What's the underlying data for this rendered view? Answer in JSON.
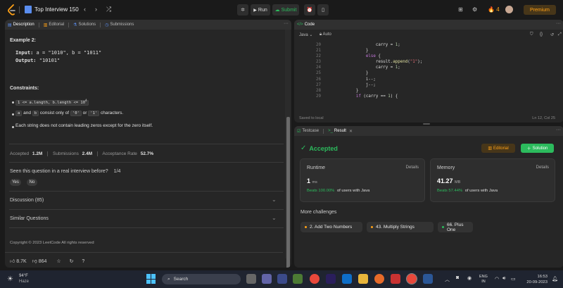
{
  "topbar": {
    "problem_list_title": "Top Interview 150",
    "prev_label": "‹",
    "next_label": "›",
    "shuffle_label": "⤮",
    "run_label": "Run",
    "submit_label": "Submit",
    "streak_count": "4",
    "premium_label": "Premium"
  },
  "description_panel": {
    "tabs": [
      "Description",
      "Editorial",
      "Solutions",
      "Submissions"
    ],
    "example_title": "Example 2:",
    "input_label": "Input:",
    "input_value": "a = \"1010\", b = \"1011\"",
    "output_label": "Output:",
    "output_value": "\"10101\"",
    "constraints_title": "Constraints:",
    "constraint_1_code": "1 <= a.length, b.length <= 10",
    "constraint_1_exp": "4",
    "constraint_2_a": "a",
    "constraint_2_and": "and",
    "constraint_2_b": "b",
    "constraint_2_text": "consist only of",
    "constraint_2_zero": "'0'",
    "constraint_2_or": "or",
    "constraint_2_one": "'1'",
    "constraint_2_end": "characters.",
    "constraint_3": "Each string does not contain leading zeros except for the zero itself.",
    "accepted_label": "Accepted",
    "accepted_value": "1.2M",
    "submissions_label": "Submissions",
    "submissions_value": "2.4M",
    "acceptance_label": "Acceptance Rate",
    "acceptance_value": "52.7%",
    "interview_question": "Seen this question in a real interview before?",
    "interview_ratio": "1/4",
    "yes_label": "Yes",
    "no_label": "No",
    "discussion_label": "Discussion (85)",
    "similar_label": "Similar Questions",
    "copyright": "Copyright © 2023 LeetCode All rights reserved",
    "likes": "8.7K",
    "dislikes": "864"
  },
  "code_panel": {
    "title": "Code",
    "language": "Java",
    "auto_label": "Auto",
    "line_numbers": [
      "20",
      "21",
      "22",
      "23",
      "24",
      "25",
      "26",
      "27",
      "28",
      "29",
      "30"
    ],
    "saved_label": "Saved to local",
    "cursor_position": "Ln 12, Col 25"
  },
  "result_panel": {
    "tabs": [
      "Testcase",
      "Result"
    ],
    "status": "Accepted",
    "editorial_btn": "Editorial",
    "solution_btn": "Solution",
    "runtime_label": "Runtime",
    "runtime_details": "Details",
    "runtime_value": "1",
    "runtime_unit": "ms",
    "runtime_beats": "Beats 100.00%",
    "runtime_beats_suffix": "of users with Java",
    "memory_label": "Memory",
    "memory_details": "Details",
    "memory_value": "41.27",
    "memory_unit": "MB",
    "memory_beats": "Beats 57.44%",
    "memory_beats_suffix": "of users with Java",
    "more_challenges_label": "More challenges",
    "challenges": [
      "2. Add Two Numbers",
      "43. Multiply Strings",
      "66. Plus One"
    ]
  },
  "taskbar": {
    "temperature": "94°F",
    "weather": "Haze",
    "search_placeholder": "Search",
    "lang_1": "ENG",
    "lang_2": "IN",
    "time": "16:53",
    "date": "20-09-2023"
  },
  "colors": {
    "accent_orange": "#ffa116",
    "accepted_green": "#2cbb5d",
    "panel_bg": "#262626"
  }
}
